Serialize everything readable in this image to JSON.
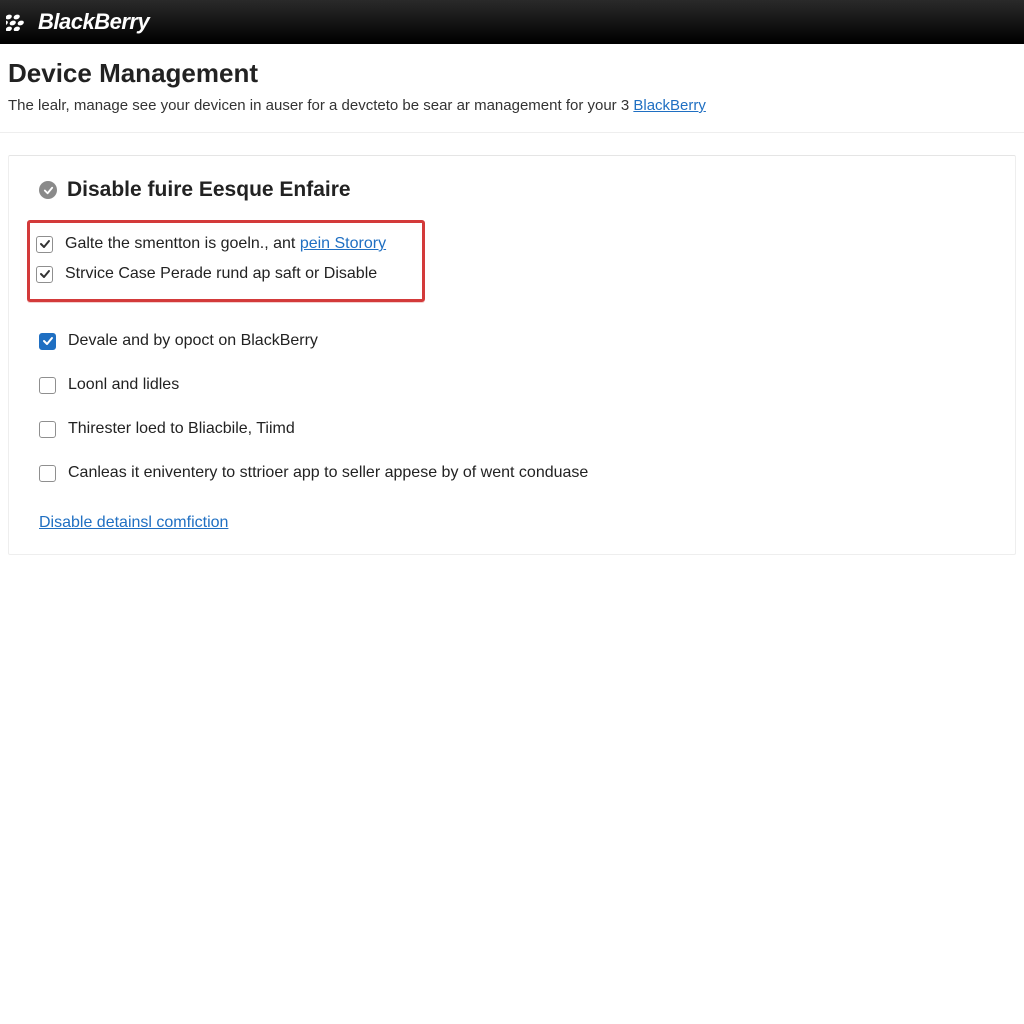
{
  "brand": {
    "name": "BlackBerry"
  },
  "header": {
    "title": "Device Management",
    "subtitle_prefix": "The lealr, manage see your devicen in auser for a devcteto be sear ar management for your 3 ",
    "subtitle_link": "BlackBerry"
  },
  "section": {
    "title": "Disable fuire Eesque Enfaire",
    "highlighted": [
      {
        "checked": true,
        "label_prefix": "Galte the smentton is goeln., ant ",
        "link": "pein Storory"
      },
      {
        "checked": true,
        "label": "Strvice Case Perade rund ap saft or Disable"
      }
    ],
    "options": [
      {
        "checked": true,
        "blue": true,
        "label": "Devale and by opoct on BlackBerry"
      },
      {
        "checked": false,
        "label": "Loonl and lidles"
      },
      {
        "checked": false,
        "label": "Thirester loed to Bliacbile, Tiimd"
      },
      {
        "checked": false,
        "label": "Canleas it eniventery to sttrioer app to seller appese by of went conduase"
      }
    ],
    "footer_link": "Disable detainsl comfiction"
  }
}
